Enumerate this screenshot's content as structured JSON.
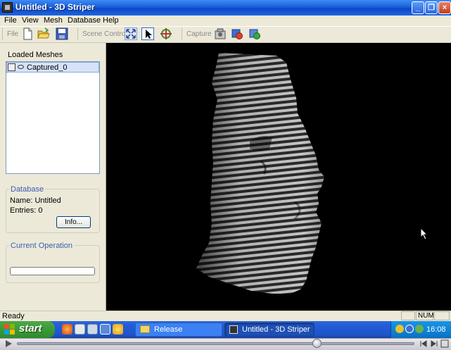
{
  "window": {
    "title": "Untitled - 3D Striper",
    "minimize_glyph": "_",
    "maximize_glyph": "❐",
    "close_glyph": "×"
  },
  "menu": [
    "File",
    "View",
    "Mesh",
    "Database",
    "Help"
  ],
  "toolbar": {
    "file_label": "File",
    "scene_label": "Scene Control",
    "capture_label": "Capture",
    "icons": [
      "new-file-icon",
      "open-folder-icon",
      "save-icon",
      "fit-view-icon",
      "pointer-icon",
      "rotate-icon",
      "camera-icon",
      "capture-blue-icon",
      "capture-green-icon"
    ]
  },
  "left_panel": {
    "loaded_title": "Loaded Meshes",
    "meshes": [
      {
        "label": "Captured_0",
        "selected": true
      }
    ],
    "database": {
      "title": "Database",
      "name_line": "Name: Untitled",
      "entries_line": "Entries: 0",
      "info_button": "Info..."
    },
    "current_operation": {
      "title": "Current Operation",
      "progress": 0
    }
  },
  "viewport": {
    "background": "#000000"
  },
  "status": {
    "text": "Ready",
    "num": "NUM"
  },
  "taskbar": {
    "start_label": "start",
    "tasks": [
      {
        "label": "Release",
        "active": false
      },
      {
        "label": "Untitled - 3D Striper",
        "active": true
      }
    ],
    "clock": "16:08"
  },
  "colors": {
    "title_blue": "#0a48c8",
    "face_gray": "#ece9d8",
    "taskbar_blue": "#245edb",
    "start_green": "#3c9a39",
    "selection": "#d6e2f7"
  }
}
